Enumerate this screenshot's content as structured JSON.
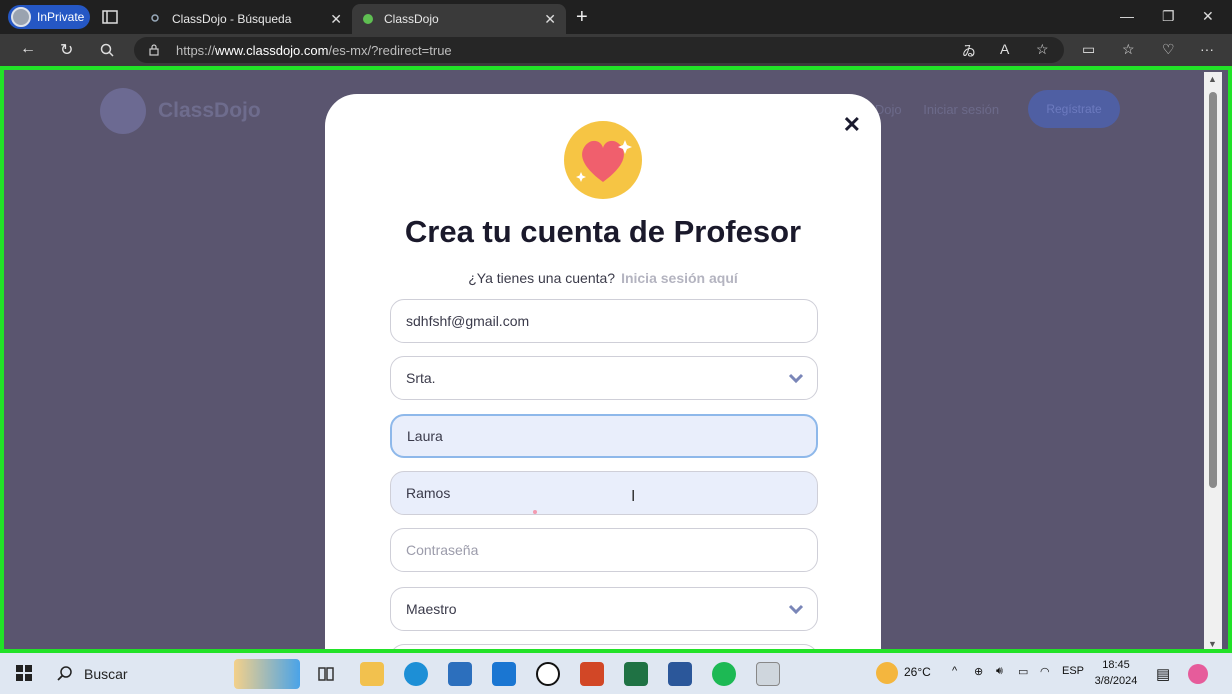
{
  "browser": {
    "inprivate_label": "InPrivate",
    "tabs": [
      {
        "title": "ClassDojo - Búsqueda"
      },
      {
        "title": "ClassDojo"
      }
    ],
    "url_prefix": "https://",
    "url_host": "www.classdojo.com",
    "url_path": "/es-mx/?redirect=true"
  },
  "site": {
    "logo_text": "ClassDojo",
    "nav_links": [
      "...Dojo",
      "Iniciar sesión"
    ],
    "cta": "Regístrate"
  },
  "modal": {
    "title": "Crea tu cuenta de Profesor",
    "subtitle": "¿Ya tienes una cuenta?",
    "login_link": "Inicia sesión aquí",
    "fields": {
      "email_value": "sdhfshf@gmail.com",
      "title_select_value": "Srta.",
      "first_name_value": "Laura",
      "last_name_value": "Ramos",
      "password_placeholder": "Contraseña",
      "role_select_value": "Maestro"
    }
  },
  "taskbar": {
    "search_label": "Buscar",
    "temperature": "26°C",
    "language": "ESP",
    "time": "18:45",
    "date": "3/8/2024"
  }
}
